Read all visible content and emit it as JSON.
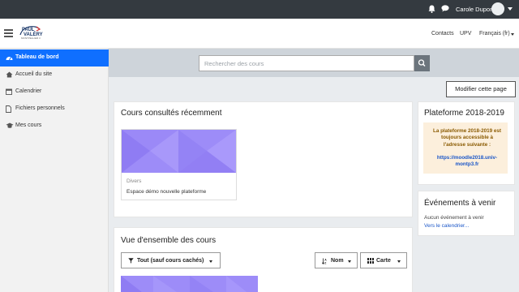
{
  "topbar": {
    "user_name": "Carole Dupont",
    "icons": [
      "bell-icon",
      "chat-icon"
    ]
  },
  "navbar": {
    "logo_line1": "PAUL",
    "logo_line2": "VALÉRY",
    "logo_line3": "MONTPELLIER 3",
    "links": {
      "contacts": "Contacts",
      "upv": "UPV",
      "language": "Français (fr)"
    }
  },
  "sidebar": {
    "items": [
      {
        "label": "Tableau de bord",
        "icon": "dashboard-icon",
        "active": true
      },
      {
        "label": "Accueil du site",
        "icon": "home-icon"
      },
      {
        "label": "Calendrier",
        "icon": "calendar-icon"
      },
      {
        "label": "Fichiers personnels",
        "icon": "file-icon"
      },
      {
        "label": "Mes cours",
        "icon": "graduation-cap-icon"
      }
    ]
  },
  "search": {
    "placeholder": "Rechercher des cours",
    "icon": "search-icon"
  },
  "page": {
    "modify_button": "Modifier cette page"
  },
  "recent": {
    "title": "Cours consultés récemment",
    "course": {
      "category": "Divers",
      "name": "Espace démo nouvelle plateforme",
      "color": "#9d8cf8"
    }
  },
  "overview": {
    "title": "Vue d'ensemble des cours",
    "filter_label": "Tout (sauf cours cachés)",
    "sort_label": "Nom",
    "view_label": "Carte"
  },
  "platform_block": {
    "title": "Plateforme 2018-2019",
    "notice": "La plateforme 2018-2019 est toujours accessible à l'adresse suivante :",
    "url": "https://moodle2018.univ-montp3.fr"
  },
  "events_block": {
    "title": "Événements à venir",
    "empty": "Aucun événement à venir",
    "calendar_link": "Vers le calendrier..."
  },
  "colors": {
    "topbar": "#343a40",
    "active": "#0f6fff",
    "course_tile": "#9d8cf8",
    "notice_bg": "#fcefdc"
  }
}
